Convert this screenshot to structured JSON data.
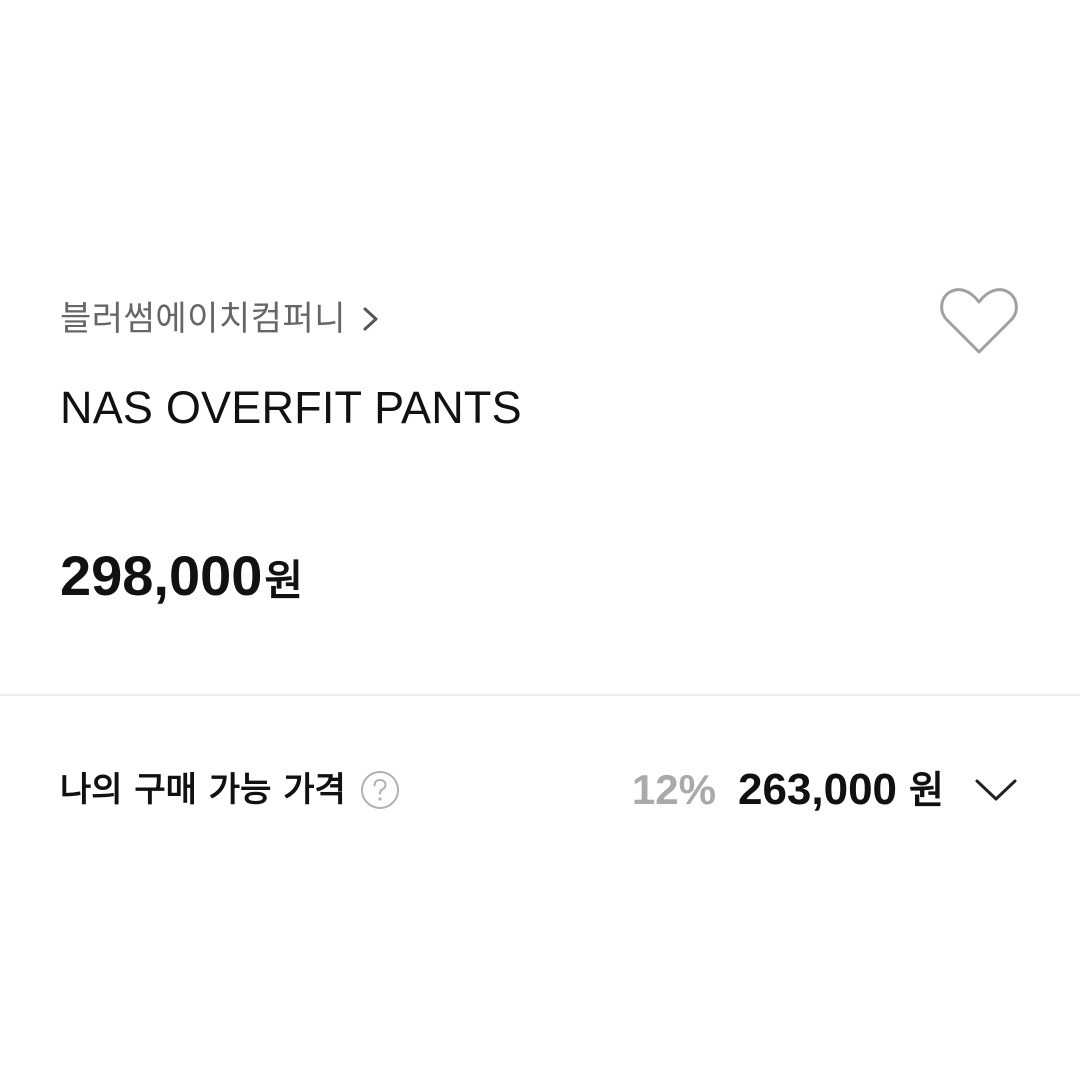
{
  "product": {
    "brand": "블러썸에이치컴퍼니",
    "name": "NAS OVERFIT PANTS",
    "price": "298,000",
    "price_unit": "원",
    "liked": false
  },
  "my_price": {
    "label": "나의 구매 가능 가격",
    "discount_rate": "12%",
    "price": "263,000",
    "price_unit": "원"
  },
  "icons": {
    "brand_link": "chevron-right-icon",
    "like": "heart-outline-icon",
    "help": "question-circle-icon",
    "expand": "chevron-down-icon"
  },
  "colors": {
    "text_primary": "#111111",
    "text_secondary": "#666666",
    "discount_rate": "#aaaaaa",
    "divider": "#eeeeee",
    "icon_gray": "#999999"
  }
}
